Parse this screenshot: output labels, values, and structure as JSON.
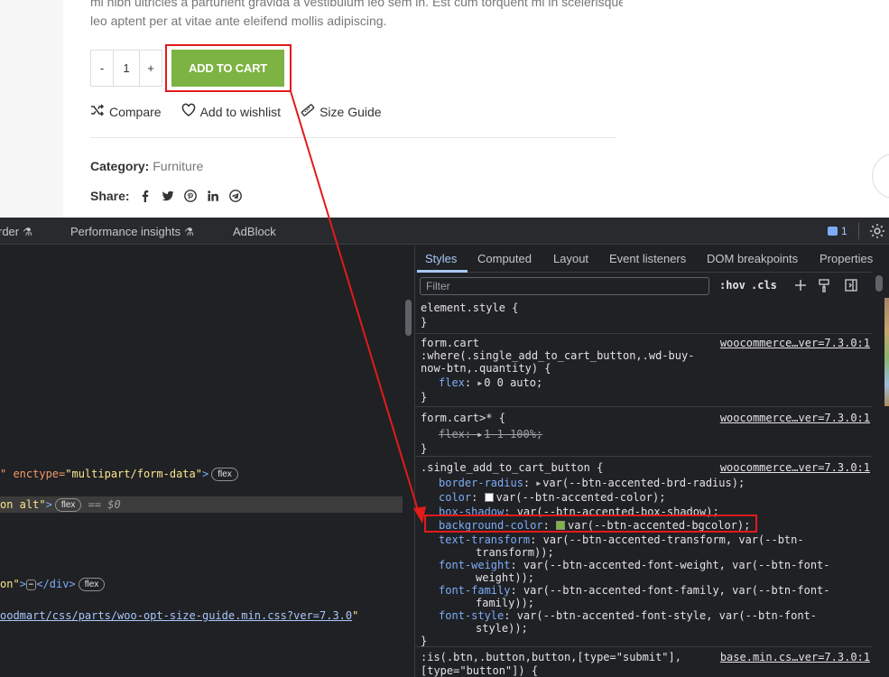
{
  "product": {
    "desc_line1": "mi nibh ultricies a parturient gravida a vestibulum leo sem in. Est cum torquent mi in scelerisque",
    "desc_line2": "leo aptent per at vitae ante eleifend mollis adipiscing.",
    "qty_minus": "-",
    "qty_value": "1",
    "qty_plus": "+",
    "add_to_cart": "ADD TO CART",
    "compare": "Compare",
    "wishlist": "Add to wishlist",
    "size_guide": "Size Guide",
    "category_label": "Category:",
    "category_value": "Furniture",
    "share_label": "Share:"
  },
  "devtools": {
    "tabs": {
      "recorder": "rder",
      "performance": "Performance insights",
      "adblock": "AdBlock"
    },
    "issues_count": "1",
    "elements": {
      "l1_attr": "\" enctype=",
      "l1_val": "\"multipart/form-data\"",
      "l1_end": ">",
      "l1_badge": "flex",
      "l2_val": "on alt\"",
      "l2_end": ">",
      "l2_badge": "flex",
      "l2_hint": "== $0",
      "l3_val": "on\"",
      "l3_mid": ">",
      "l3_ell": "⋯",
      "l3_close": "</div>",
      "l3_badge": "flex",
      "l4_link": "oodmart/css/parts/woo-opt-size-guide.min.css?ver=7.3.0",
      "l4_end": "\""
    },
    "styles_tabs": [
      "Styles",
      "Computed",
      "Layout",
      "Event listeners",
      "DOM breakpoints",
      "Properties"
    ],
    "filter_placeholder": "Filter",
    "hov": ":hov",
    "cls": ".cls",
    "rules": {
      "r0_sel": "element.style {",
      "r0_close": "}",
      "r1_sel1": "form.cart",
      "r1_sel2": ":where(.single_add_to_cart_button,.wd-buy-",
      "r1_sel3": "now-btn,.quantity) {",
      "r1_src": "woocommerce…ver=7.3.0:1",
      "r1_prop": "flex",
      "r1_val": "0 0 auto;",
      "r1_close": "}",
      "r2_sel": "form.cart>* {",
      "r2_src": "woocommerce…ver=7.3.0:1",
      "r2_prop": "flex",
      "r2_val": "1 1 100%;",
      "r2_close": "}",
      "r3_sel": ".single_add_to_cart_button {",
      "r3_src": "woocommerce…ver=7.3.0:1",
      "p1_name": "border-radius",
      "p1_val": "var(--btn-accented-brd-radius);",
      "p2_name": "color",
      "p2_val": "var(--btn-accented-color);",
      "p3_name": "box-shadow",
      "p3_val": "var(--btn-accented-box-shadow);",
      "p4_name": "background-color",
      "p4_val": "var(--btn-accented-bgcolor);",
      "p5_name": "text-transform",
      "p5_val": "var(--btn-accented-transform, var(--btn-",
      "p5_cont": "transform));",
      "p6_name": "font-weight",
      "p6_val": "var(--btn-accented-font-weight, var(--btn-font-",
      "p6_cont": "weight));",
      "p7_name": "font-family",
      "p7_val": "var(--btn-accented-font-family, var(--btn-font-",
      "p7_cont": "family));",
      "p8_name": "font-style",
      "p8_val": "var(--btn-accented-font-style, var(--btn-font-",
      "p8_cont": "style));",
      "r3_close": "}",
      "r4_sel1": ":is(.btn,.button,button,[type=\"submit\"],",
      "r4_sel2": "[type=\"button\"]) {",
      "r4_src": "base.min.cs…ver=7.3.0:1"
    }
  },
  "colors": {
    "accent_green": "#7cb342",
    "highlight_red": "#e21b1b",
    "devtools_bg": "#202124",
    "swatch_white": "#ffffff"
  }
}
